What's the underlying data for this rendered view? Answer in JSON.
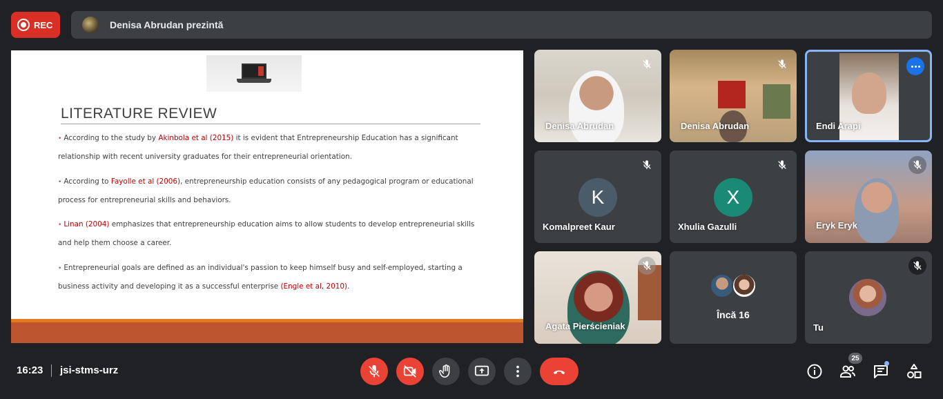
{
  "recording": {
    "label": "REC"
  },
  "presenting_bar": {
    "text": "Denisa Abrudan prezintă"
  },
  "slide": {
    "title": "LITERATURE REVIEW",
    "bullets": [
      {
        "pre": "According to the study by ",
        "cite": "Akinbola et al (2015)",
        "post": " it is evident that Entrepreneurship Education has a significant relationship with recent university graduates for their entrepreneurial orientation."
      },
      {
        "pre": "According to ",
        "cite": "Fayolle et al (2006)",
        "post": ", entrepreneurship education consists of any pedagogical program or educational process for entrepreneurial skills and behaviors."
      },
      {
        "pre": "",
        "cite": "Linan (2004)",
        "post": " emphasizes that entrepreneurship education aims to allow students to develop entrepreneurial skills and help them choose a career."
      },
      {
        "pre": "Entrepreneurial goals are defined as an individual's passion to keep himself busy and self-employed, starting a business activity and developing it as a successful enterprise ",
        "cite": "(Engle et al, 2010)",
        "post": "."
      }
    ]
  },
  "tiles": [
    {
      "name": "Denisa Abrudan",
      "muted": true
    },
    {
      "name": "Denisa Abrudan",
      "muted": true
    },
    {
      "name": "Endi Arapi",
      "active": true
    },
    {
      "name": "Komalpreet Kaur",
      "initial": "K",
      "avatar_color": "#4a5b6a",
      "muted": true
    },
    {
      "name": "Xhulia Gazulli",
      "initial": "X",
      "avatar_color": "#1a8a76",
      "muted": true
    },
    {
      "name": "Eryk Eryk",
      "muted": true
    },
    {
      "name": "Agata Pierścieniak",
      "muted": true
    },
    {
      "name": "Încă 16"
    },
    {
      "name": "Tu",
      "muted": true
    }
  ],
  "bottom_bar": {
    "time": "16:23",
    "meeting_code": "jsi-stms-urz",
    "controls": [
      "mic-off-icon",
      "camera-off-icon",
      "raise-hand-icon",
      "present-screen-icon",
      "more-options-icon",
      "end-call-icon"
    ],
    "people_count": "25"
  },
  "colors": {
    "background": "#202124",
    "danger": "#ea4335",
    "accent": "#1a73e8",
    "tile": "#3c4043"
  }
}
